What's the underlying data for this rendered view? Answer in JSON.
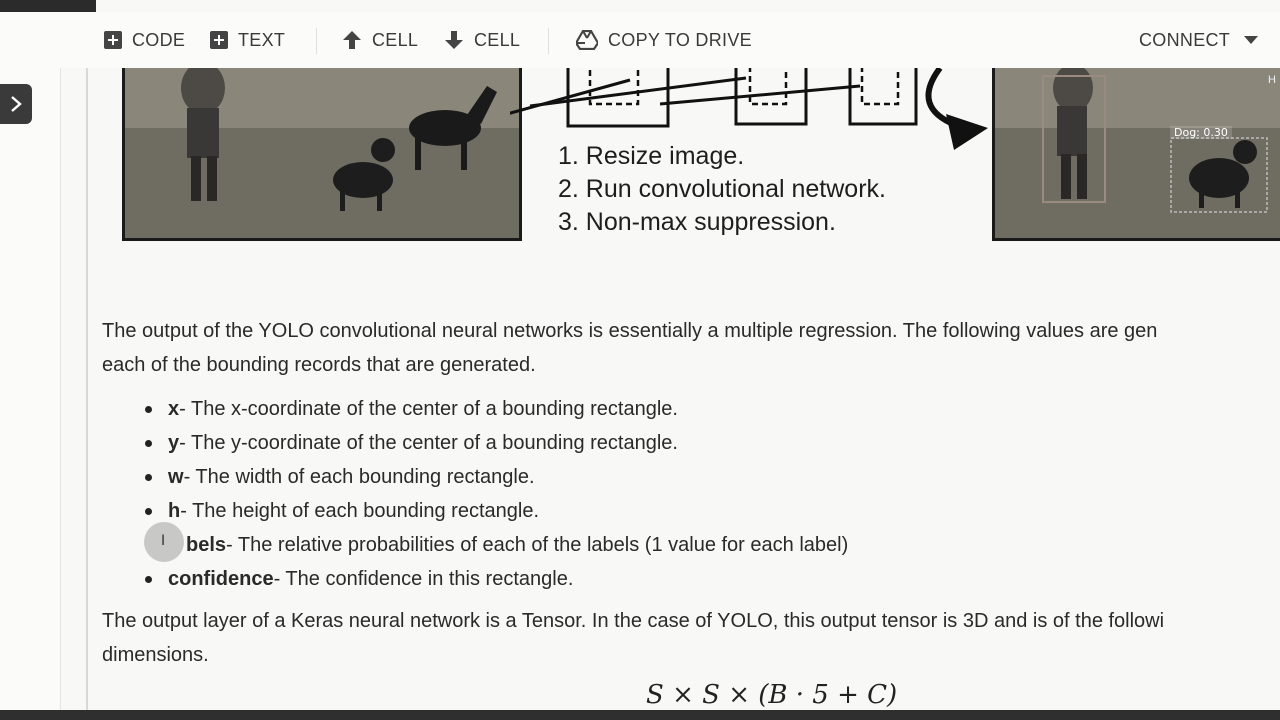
{
  "toolbar": {
    "code_label": "CODE",
    "text_label": "TEXT",
    "cell_up_label": "CELL",
    "cell_down_label": "CELL",
    "copy_drive_label": "COPY TO DRIVE",
    "connect_label": "CONNECT"
  },
  "figure": {
    "steps": [
      "1. Resize image.",
      "2. Run convolutional network.",
      "3. Non-max suppression."
    ],
    "detection_label": "Dog: 0.30",
    "corner_label": "H"
  },
  "paragraph1": {
    "line1": "The output of the YOLO convolutional neural networks is essentially a multiple regression. The following values are gen",
    "line2": "each of the bounding records that are generated."
  },
  "bullets": [
    {
      "term": "x",
      "desc": " - The x-coordinate of the center of a bounding rectangle."
    },
    {
      "term": "y",
      "desc": " - The y-coordinate of the center of a bounding rectangle."
    },
    {
      "term": "w",
      "desc": " - The width of each bounding rectangle."
    },
    {
      "term": "h",
      "desc": " - The height of each bounding rectangle."
    },
    {
      "term": "bels",
      "desc": " - The relative probabilities of each of the labels (1 value for each label)"
    },
    {
      "term": "confidence",
      "desc": " - The confidence in this rectangle."
    }
  ],
  "paragraph2": {
    "line1": "The output layer of a Keras neural network is a Tensor. In the case of YOLO, this output tensor is 3D and is of the followi",
    "line2": "dimensions."
  },
  "formula": "S × S × (B · 5 + C)"
}
